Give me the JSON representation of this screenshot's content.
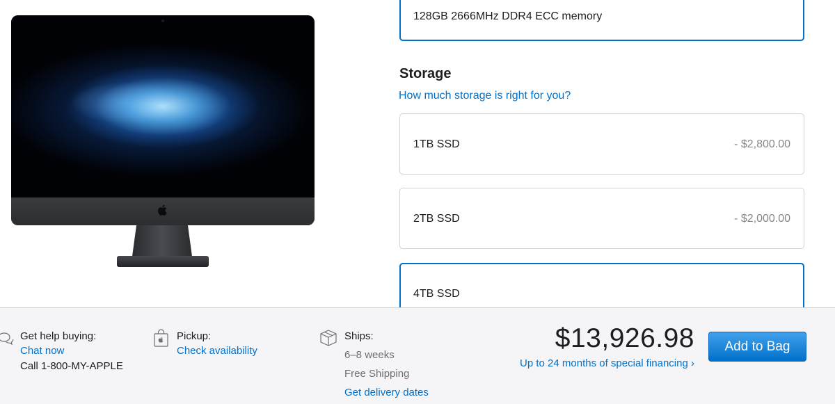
{
  "memory": {
    "selected_label": "128GB 2666MHz DDR4 ECC memory"
  },
  "storage": {
    "title": "Storage",
    "help_link": "How much storage is right for you?",
    "options": [
      {
        "label": "1TB SSD",
        "price": "- $2,800.00",
        "selected": false
      },
      {
        "label": "2TB SSD",
        "price": "- $2,000.00",
        "selected": false
      },
      {
        "label": "4TB SSD",
        "price": "",
        "selected": true
      }
    ]
  },
  "footer": {
    "help": {
      "title": "Get help buying:",
      "chat": "Chat now",
      "phone": "Call 1-800-MY-APPLE",
      "icon": "chat-bubbles-icon"
    },
    "pickup": {
      "title": "Pickup:",
      "link": "Check availability",
      "icon": "shopping-bag-icon"
    },
    "ships": {
      "title": "Ships:",
      "time": "6–8 weeks",
      "shipping": "Free Shipping",
      "link": "Get delivery dates",
      "icon": "box-icon"
    },
    "total": "$13,926.98",
    "financing": "Up to 24 months of special financing",
    "financing_chevron": "›",
    "add_button": "Add to Bag"
  },
  "colors": {
    "accent": "#0070c9",
    "footer_bg": "#f5f5f7",
    "muted": "#86868b"
  }
}
